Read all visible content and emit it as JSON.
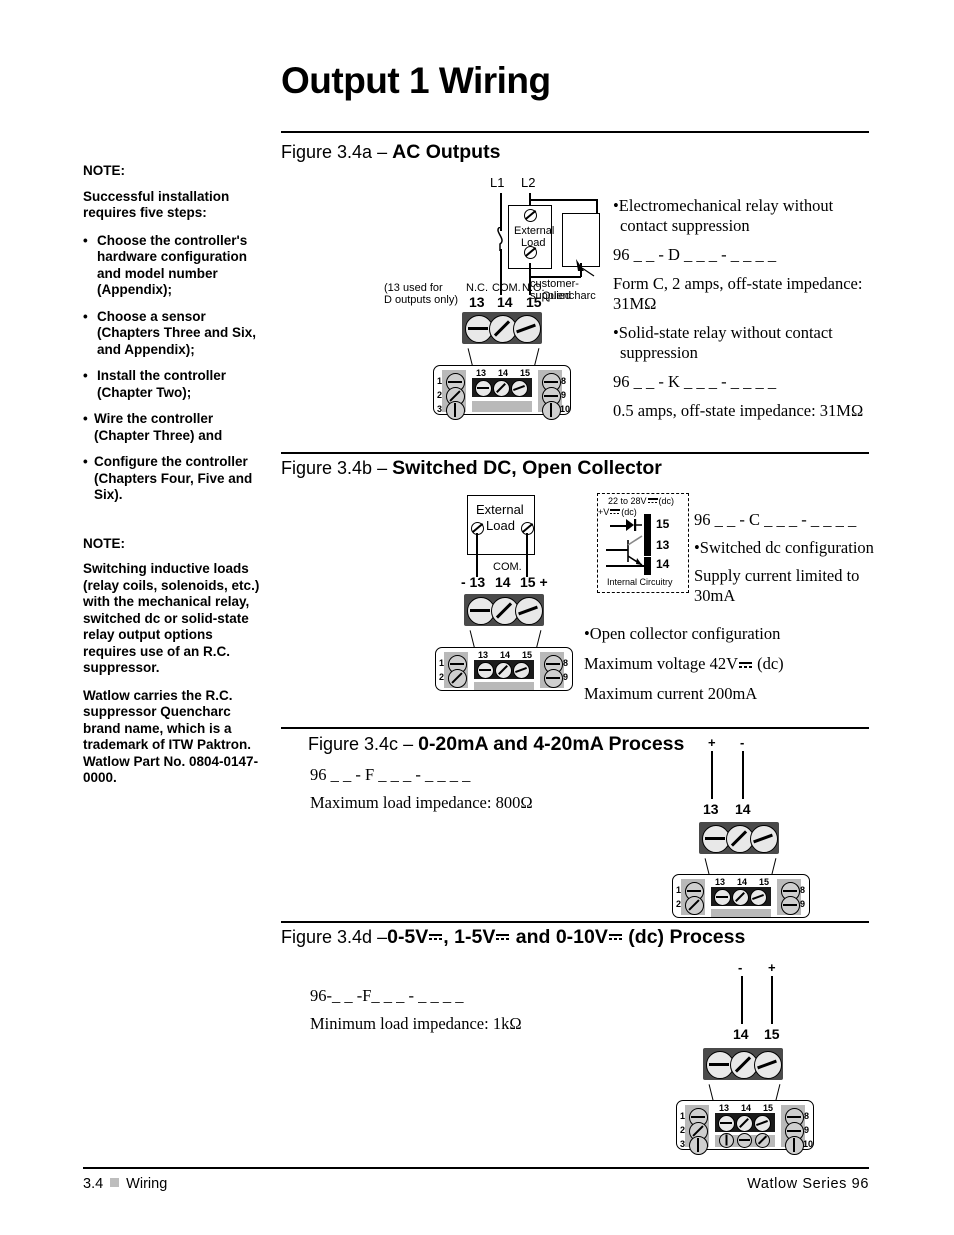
{
  "page": {
    "title": "Output 1 Wiring"
  },
  "sidebar": {
    "note1_label": "NOTE:",
    "note1_intro": "Successful installation requires five steps:",
    "note1_items": [
      "Choose the controller's hardware configuration and model number (Appendix);",
      "Choose a sensor (Chapters Three and Six, and Appendix);",
      "Install the controller (Chapter Two);",
      "Wire the controller (Chapter Three) and",
      "Configure the controller (Chapters Four, Five and Six)."
    ],
    "note2_label": "NOTE:",
    "note2_para1": "Switching inductive loads (relay coils, solenoids, etc.) with the mechanical relay, switched dc or solid-state relay output options requires use of an R.C. suppressor.",
    "note2_para2": "Watlow carries the R.C. suppressor Quencharc brand name, which is a trademark of ITW Paktron. Watlow Part No. 0804-0147-0000."
  },
  "fig_a": {
    "label": "Figure 3.4a",
    "dash": "–",
    "title": "AC Outputs",
    "l1": "L1",
    "l2": "L2",
    "external_load_1": "External",
    "external_load_2": "Load",
    "quencharc_1": "customer-supplied",
    "quencharc_2": "Quencharc",
    "note_13a": "(13 used for",
    "note_13b": "D outputs only)",
    "nc": "N.C.",
    "com": "COM.",
    "no": "N.O.",
    "t13": "13",
    "t14": "14",
    "t15": "15",
    "bullet1": "•Electromechanical relay without contact suppression",
    "model1": "96 _ _ - D _ _ _ - _ _ _ _",
    "spec1": "Form C, 2 amps, off-state impedance: 31MΩ",
    "bullet2": "•Solid-state relay without contact suppression",
    "model2": "96 _ _ - K _ _ _ - _ _ _ _",
    "spec2": "0.5 amps, off-state impedance: 31MΩ"
  },
  "fig_b": {
    "label": "Figure 3.4b",
    "dash": "–",
    "title": "Switched DC, Open Collector",
    "external_load_1": "External",
    "external_load_2": "Load",
    "com": "COM.",
    "t13": "- 13",
    "t14": "14",
    "t15": "15 +",
    "supply_range": "22 to 28V",
    "supply_range_suffix": "(dc)",
    "plus_v": "+V",
    "plus_v_suffix": "(dc)",
    "internal_circuitry": "Internal Circuitry",
    "b15": "15",
    "b13": "13",
    "b14": "14",
    "model": "96 _ _ - C _ _ _ - _ _ _ _",
    "bullet1": "•Switched dc configuration",
    "spec1": "Supply current limited to 30mA",
    "bullet2": "•Open collector configuration",
    "spec2_pre": "Maximum voltage 42V",
    "spec2_post": "(dc)",
    "spec3": "Maximum current 200mA"
  },
  "fig_c": {
    "label": "Figure 3.4c",
    "dash": "–",
    "title": "0-20mA and 4-20mA Process",
    "model": "96 _ _ - F _ _ _ - _ _ _ _",
    "spec": "Maximum load impedance: 800Ω",
    "plus": "+",
    "minus": "-",
    "t13": "13",
    "t14": "14"
  },
  "fig_d": {
    "label": "Figure 3.4d",
    "dash": "–",
    "title_1": "0-5V",
    "title_2": ", 1-5V",
    "title_3": " and 0-10V",
    "title_4": " (dc) Process",
    "model": "96-_ _ -F_ _ _ - _ _ _ _",
    "spec": "Minimum load impedance: 1kΩ",
    "minus": "-",
    "plus": "+",
    "t14": "14",
    "t15": "15"
  },
  "controller": {
    "left_nums": [
      "1",
      "2",
      "3"
    ],
    "right_nums": [
      "8",
      "9",
      "10"
    ],
    "top_nums": [
      "13",
      "14",
      "15"
    ]
  },
  "footer": {
    "left_page": "3.4",
    "left_section": "Wiring",
    "right": "Watlow Series 96"
  },
  "colors": {
    "ink": "#000000",
    "connector_body": "#4a4a4a",
    "controller_column": "#b9b9b9",
    "footer_square": "#bdbdbd"
  }
}
